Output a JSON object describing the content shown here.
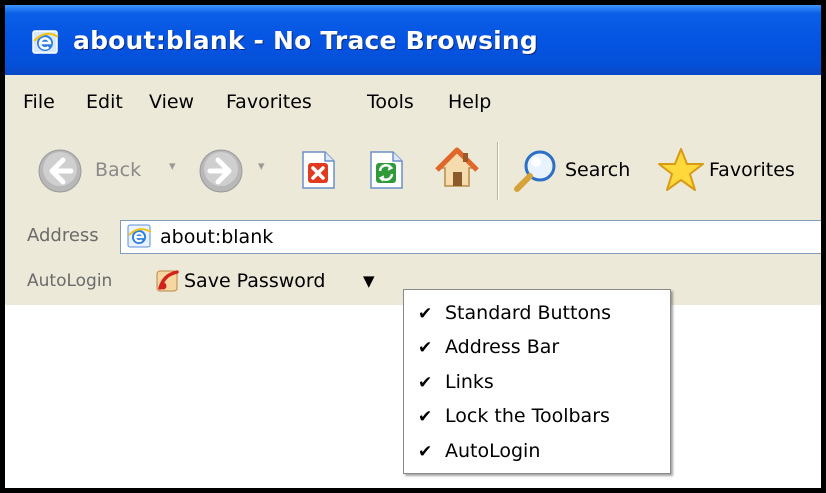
{
  "window": {
    "title": "about:blank - No Trace Browsing"
  },
  "menubar": {
    "items": [
      "File",
      "Edit",
      "View",
      "Favorites",
      "Tools",
      "Help"
    ]
  },
  "toolbar": {
    "back_label": "Back",
    "search_label": "Search",
    "favorites_label": "Favorites",
    "icons": [
      "back-icon",
      "forward-icon",
      "stop-icon",
      "refresh-icon",
      "home-icon",
      "search-icon",
      "favorites-star-icon"
    ]
  },
  "address": {
    "label": "Address",
    "value": "about:blank",
    "icon": "ie-page-icon"
  },
  "autologin": {
    "label": "AutoLogin",
    "save_password": "Save Password",
    "icon": "autologin-key-icon"
  },
  "context_menu": {
    "items": [
      {
        "label": "Standard Buttons",
        "checked": true
      },
      {
        "label": "Address Bar",
        "checked": true
      },
      {
        "label": "Links",
        "checked": true
      },
      {
        "label": "Lock the Toolbars",
        "checked": true
      },
      {
        "label": "AutoLogin",
        "checked": true
      }
    ]
  },
  "colors": {
    "titlebar": "#0554e3",
    "chrome": "#ece9d8",
    "nav_gray": "#a0a0a0"
  }
}
